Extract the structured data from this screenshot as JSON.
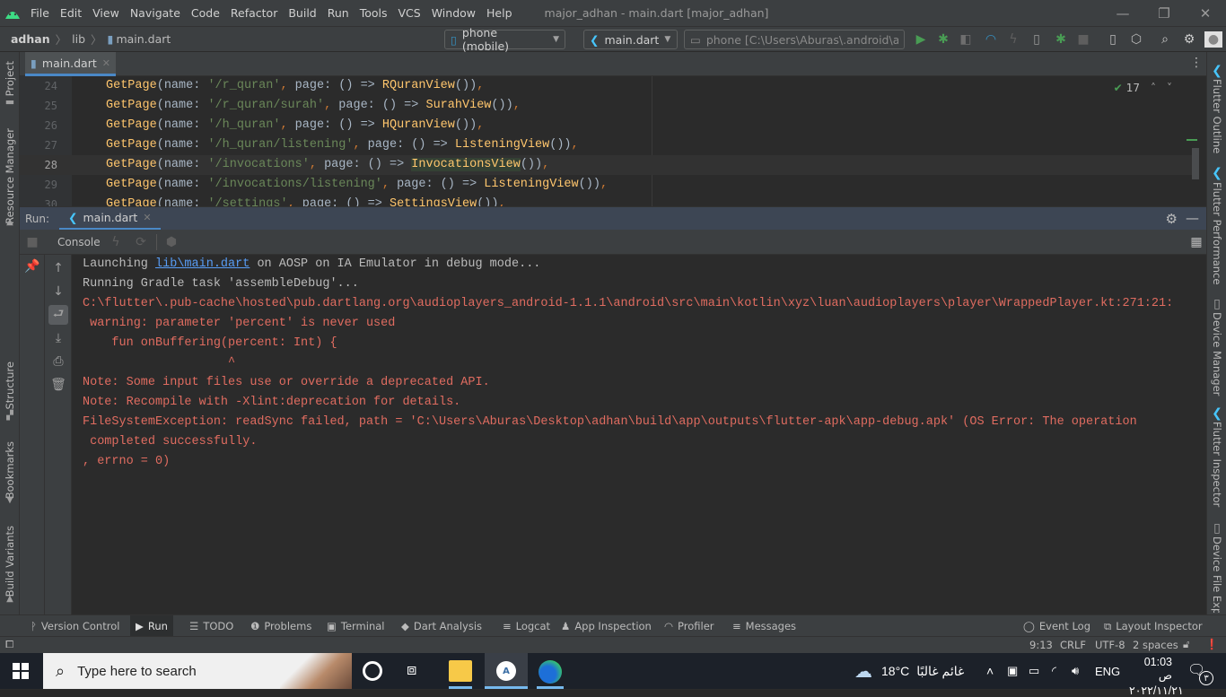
{
  "window": {
    "title": "major_adhan - main.dart [major_adhan]",
    "menu": [
      "File",
      "Edit",
      "View",
      "Navigate",
      "Code",
      "Refactor",
      "Build",
      "Run",
      "Tools",
      "VCS",
      "Window",
      "Help"
    ],
    "controls": {
      "minimize": "—",
      "restore": "❐",
      "close": "✕"
    }
  },
  "navbar": {
    "breadcrumb": [
      "adhan",
      "lib",
      "main.dart"
    ],
    "device_selector": "phone (mobile)",
    "run_config": "main.dart",
    "avd_selector": "phone [C:\\Users\\Aburas\\.android\\avd\\..."
  },
  "left_strip": [
    "Project",
    "Resource Manager",
    "Structure",
    "Bookmarks",
    "Build Variants"
  ],
  "right_strip": [
    "Flutter Outline",
    "Flutter Performance",
    "Device Manager",
    "Flutter Inspector",
    "Device File Explorer"
  ],
  "editor": {
    "tab": "main.dart",
    "inspections_count": "17",
    "lines": [
      {
        "n": "24",
        "parts": [
          [
            "fn",
            "GetPage"
          ],
          [
            "p",
            "(name: "
          ],
          [
            "str",
            "'/r_quran'"
          ],
          [
            "kw",
            ", "
          ],
          [
            "p",
            "page: () => "
          ],
          [
            "fn",
            "RQuranView"
          ],
          [
            "p",
            "()"
          ],
          [
            "p",
            ")"
          ],
          [
            "kw",
            ","
          ]
        ]
      },
      {
        "n": "25",
        "parts": [
          [
            "fn",
            "GetPage"
          ],
          [
            "p",
            "(name: "
          ],
          [
            "str",
            "'/r_quran/surah'"
          ],
          [
            "kw",
            ", "
          ],
          [
            "p",
            "page: () => "
          ],
          [
            "fn",
            "SurahView"
          ],
          [
            "p",
            "()"
          ],
          [
            "p",
            ")"
          ],
          [
            "kw",
            ","
          ]
        ]
      },
      {
        "n": "26",
        "parts": [
          [
            "fn",
            "GetPage"
          ],
          [
            "p",
            "(name: "
          ],
          [
            "str",
            "'/h_quran'"
          ],
          [
            "kw",
            ", "
          ],
          [
            "p",
            "page: () => "
          ],
          [
            "fn",
            "HQuranView"
          ],
          [
            "p",
            "()"
          ],
          [
            "p",
            ")"
          ],
          [
            "kw",
            ","
          ]
        ]
      },
      {
        "n": "27",
        "parts": [
          [
            "fn",
            "GetPage"
          ],
          [
            "p",
            "(name: "
          ],
          [
            "str",
            "'/h_quran/listening'"
          ],
          [
            "kw",
            ", "
          ],
          [
            "p",
            "page: () => "
          ],
          [
            "fn",
            "ListeningView"
          ],
          [
            "p",
            "()"
          ],
          [
            "p",
            ")"
          ],
          [
            "kw",
            ","
          ]
        ]
      },
      {
        "n": "28",
        "parts": [
          [
            "fn",
            "GetPage"
          ],
          [
            "p",
            "(name: "
          ],
          [
            "str",
            "'/invocations'"
          ],
          [
            "kw",
            ", "
          ],
          [
            "p",
            "page: () => "
          ],
          [
            "hl",
            "InvocationsView"
          ],
          [
            "p",
            "()"
          ],
          [
            "p",
            ")"
          ],
          [
            "kw",
            ","
          ]
        ]
      },
      {
        "n": "29",
        "parts": [
          [
            "fn",
            "GetPage"
          ],
          [
            "p",
            "(name: "
          ],
          [
            "str",
            "'/invocations/listening'"
          ],
          [
            "kw",
            ", "
          ],
          [
            "p",
            "page: () => "
          ],
          [
            "fn",
            "ListeningView"
          ],
          [
            "p",
            "()"
          ],
          [
            "p",
            ")"
          ],
          [
            "kw",
            ","
          ]
        ]
      },
      {
        "n": "30",
        "parts": [
          [
            "fn",
            "GetPage"
          ],
          [
            "p",
            "(name: "
          ],
          [
            "str",
            "'/settings'"
          ],
          [
            "kw",
            ", "
          ],
          [
            "p",
            "page: () => "
          ],
          [
            "fn",
            "SettingsView"
          ],
          [
            "p",
            "()"
          ],
          [
            "p",
            ")"
          ],
          [
            "kw",
            ","
          ]
        ]
      }
    ]
  },
  "run_panel": {
    "label": "Run:",
    "tab": "main.dart",
    "console_tab": "Console",
    "output": [
      {
        "type": "n",
        "pre": "Launching ",
        "link": "lib\\main.dart",
        "post": " on AOSP on IA Emulator in debug mode..."
      },
      {
        "type": "n",
        "text": "Running Gradle task 'assembleDebug'..."
      },
      {
        "type": "e",
        "text": "C:\\flutter\\.pub-cache\\hosted\\pub.dartlang.org\\audioplayers_android-1.1.1\\android\\src\\main\\kotlin\\xyz\\luan\\audioplayers\\player\\WrappedPlayer.kt:271:21:"
      },
      {
        "type": "e",
        "text": " warning: parameter 'percent' is never used"
      },
      {
        "type": "e",
        "text": "    fun onBuffering(percent: Int) {"
      },
      {
        "type": "e",
        "text": "                    ^"
      },
      {
        "type": "e",
        "text": "Note: Some input files use or override a deprecated API."
      },
      {
        "type": "e",
        "text": "Note: Recompile with -Xlint:deprecation for details."
      },
      {
        "type": "e",
        "text": "FileSystemException: readSync failed, path = 'C:\\Users\\Aburas\\Desktop\\adhan\\build\\app\\outputs\\flutter-apk\\app-debug.apk' (OS Error: The operation"
      },
      {
        "type": "e",
        "text": " completed successfully."
      },
      {
        "type": "e",
        "text": ", errno = 0)"
      }
    ]
  },
  "bottom_tabs": [
    "Version Control",
    "Run",
    "TODO",
    "Problems",
    "Terminal",
    "Dart Analysis",
    "Logcat",
    "App Inspection",
    "Profiler",
    "Messages"
  ],
  "bottom_right_tabs": [
    "Event Log",
    "Layout Inspector"
  ],
  "status": {
    "position": "9:13",
    "line_sep": "CRLF",
    "encoding": "UTF-8",
    "indent": "2 spaces"
  },
  "taskbar": {
    "search_placeholder": "Type here to search",
    "weather_temp": "18°C",
    "weather_desc": "غائم غالبًا",
    "language": "ENG",
    "time": "01:03 ص",
    "date": "٢٠٢٢/١١/٢١",
    "notifications": "٣"
  }
}
